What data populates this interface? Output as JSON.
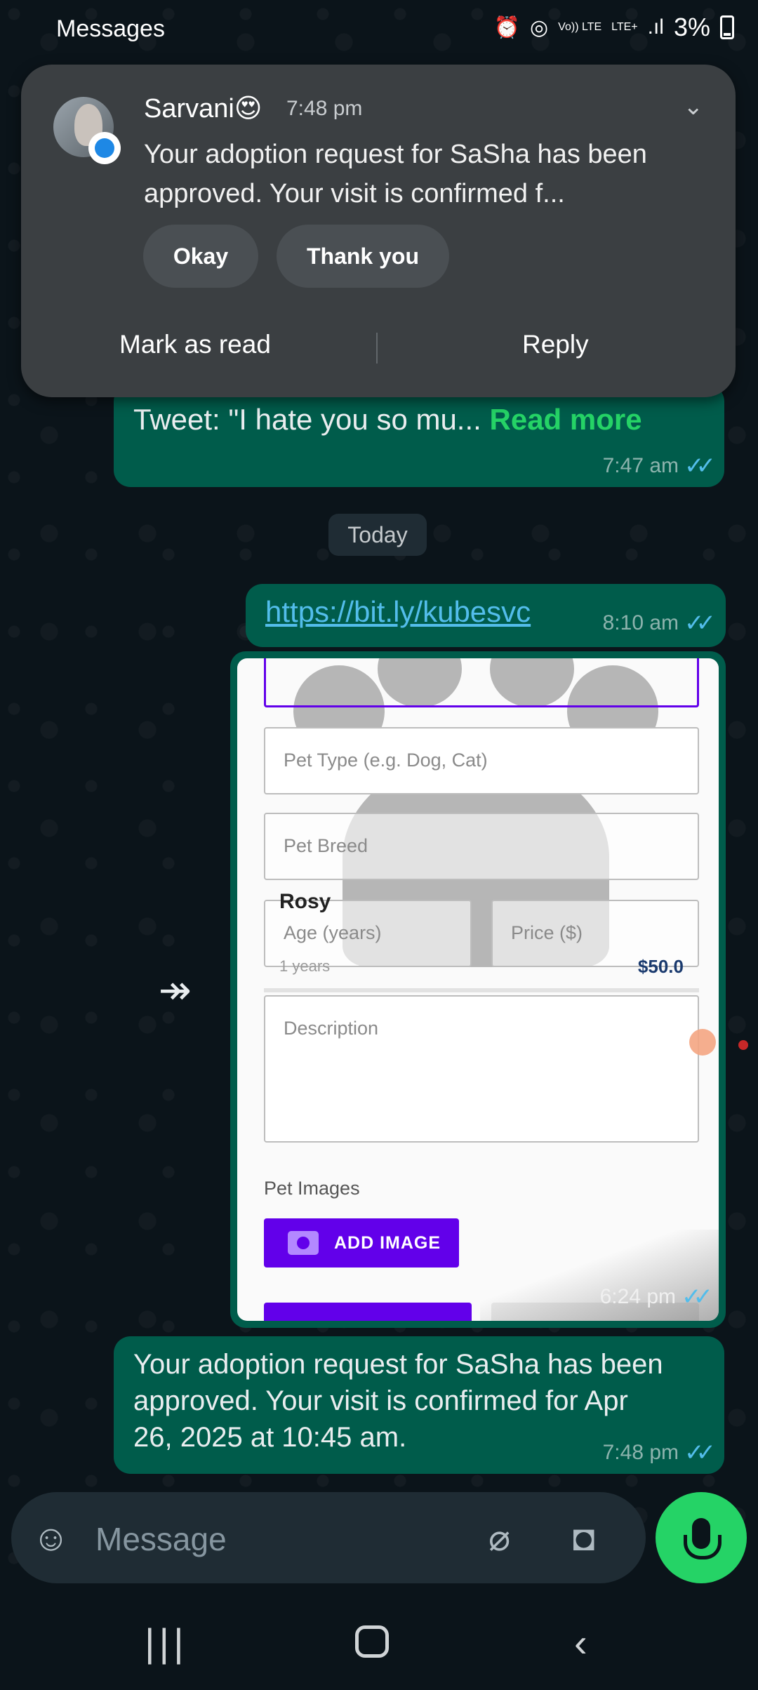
{
  "status_bar": {
    "app_name": "Messages",
    "icons": [
      "alarm-icon",
      "hotspot-icon",
      "volte-icon",
      "lte-plus-icon",
      "signal-icon"
    ],
    "volte_text": "Vo)) LTE",
    "lte_text": "LTE+",
    "battery": "3%"
  },
  "notification": {
    "sender": "Sarvani😍",
    "time": "7:48 pm",
    "body": "Your adoption request for SaSha has been approved. Your visit is confirmed f...",
    "quick_replies": [
      "Okay",
      "Thank you"
    ],
    "mark_read_label": "Mark as read",
    "reply_label": "Reply"
  },
  "chat": {
    "msg1_text": "Tweet: \"I hate you so mu... ",
    "msg1_readmore": "Read more",
    "msg1_time": "7:47 am",
    "date_label": "Today",
    "msg2_link": "https://bit.ly/kubesvc",
    "msg2_time": "8:10 am",
    "msg3_time": "6:24 pm",
    "msg4_text": "Your adoption request for SaSha has been approved. Your visit is confirmed for Apr 26, 2025 at 10:45 am.",
    "msg4_time": "7:48 pm"
  },
  "form_screenshot": {
    "pet_type_placeholder": "Pet Type (e.g. Dog, Cat)",
    "pet_breed_placeholder": "Pet Breed",
    "age_placeholder": "Age (years)",
    "price_placeholder": "Price ($)",
    "card_name": "Rosy",
    "card_age": "1 years",
    "card_price": "$50.0",
    "description_placeholder": "Description",
    "pet_images_label": "Pet Images",
    "add_image_label": "ADD IMAGE"
  },
  "input_bar": {
    "placeholder": "Message"
  },
  "colors": {
    "background": "#0b141a",
    "outgoing_bubble": "#005c4b",
    "accent_green": "#25d366",
    "link_blue": "#53bdeb",
    "button_purple": "#6200ea"
  }
}
